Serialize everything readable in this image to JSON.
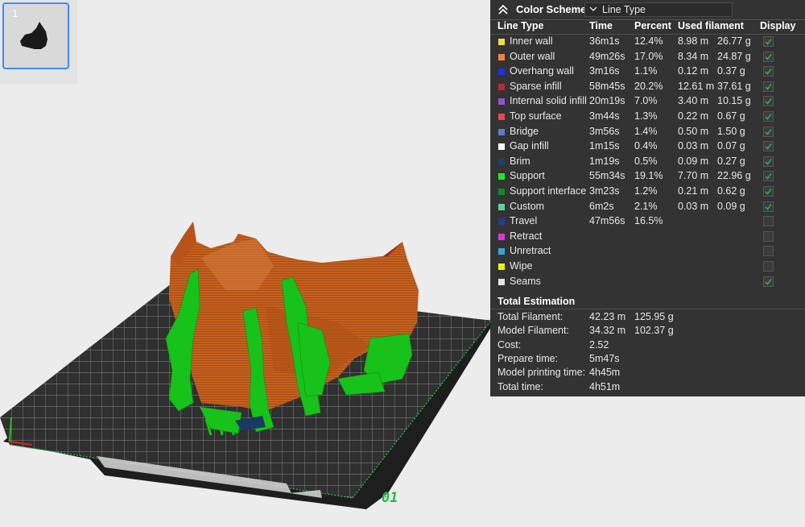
{
  "plate": {
    "thumbnail_index": "1",
    "plate_number": "01",
    "grid_color": "#2e2e2e",
    "model_color": "#c5611f",
    "support_color": "#19c11c"
  },
  "panel": {
    "title": "Color Scheme",
    "collapse_icon": "chevron-up-double-icon",
    "scheme_value": "Line Type",
    "headers": {
      "line_type": "Line Type",
      "time": "Time",
      "percent": "Percent",
      "used_filament": "Used filament",
      "display": "Display"
    },
    "rows": [
      {
        "name": "Inner wall",
        "color": "#f5dc44",
        "time": "36m1s",
        "percent": "12.4%",
        "length": "8.98 m",
        "weight": "26.77 g",
        "checked": true
      },
      {
        "name": "Outer wall",
        "color": "#f0824a",
        "time": "49m26s",
        "percent": "17.0%",
        "length": "8.34 m",
        "weight": "24.87 g",
        "checked": true
      },
      {
        "name": "Overhang wall",
        "color": "#2230e8",
        "time": "3m16s",
        "percent": "1.1%",
        "length": "0.12 m",
        "weight": "0.37 g",
        "checked": true
      },
      {
        "name": "Sparse infill",
        "color": "#b22d38",
        "time": "58m45s",
        "percent": "20.2%",
        "length": "12.61 m",
        "weight": "37.61 g",
        "checked": true
      },
      {
        "name": "Internal solid infill",
        "color": "#9b4fd1",
        "time": "20m19s",
        "percent": "7.0%",
        "length": "3.40 m",
        "weight": "10.15 g",
        "checked": true
      },
      {
        "name": "Top surface",
        "color": "#e84a4a",
        "time": "3m44s",
        "percent": "1.3%",
        "length": "0.22 m",
        "weight": "0.67 g",
        "checked": true
      },
      {
        "name": "Bridge",
        "color": "#5b7fc8",
        "time": "3m56s",
        "percent": "1.4%",
        "length": "0.50 m",
        "weight": "1.50 g",
        "checked": true
      },
      {
        "name": "Gap infill",
        "color": "#ffffff",
        "time": "1m15s",
        "percent": "0.4%",
        "length": "0.03 m",
        "weight": "0.07 g",
        "checked": true
      },
      {
        "name": "Brim",
        "color": "#1a4266",
        "time": "1m19s",
        "percent": "0.5%",
        "length": "0.09 m",
        "weight": "0.27 g",
        "checked": true
      },
      {
        "name": "Support",
        "color": "#22e82a",
        "time": "55m34s",
        "percent": "19.1%",
        "length": "7.70 m",
        "weight": "22.96 g",
        "checked": true
      },
      {
        "name": "Support interface",
        "color": "#168a22",
        "time": "3m23s",
        "percent": "1.2%",
        "length": "0.21 m",
        "weight": "0.62 g",
        "checked": true
      },
      {
        "name": "Custom",
        "color": "#5fcf9b",
        "time": "6m2s",
        "percent": "2.1%",
        "length": "0.03 m",
        "weight": "0.09 g",
        "checked": true
      },
      {
        "name": "Travel",
        "color": "#2a3a8a",
        "time": "47m56s",
        "percent": "16.5%",
        "length": "",
        "weight": "",
        "checked": false
      },
      {
        "name": "Retract",
        "color": "#d23bd2",
        "time": "",
        "percent": "",
        "length": "",
        "weight": "",
        "checked": false
      },
      {
        "name": "Unretract",
        "color": "#3aa6d8",
        "time": "",
        "percent": "",
        "length": "",
        "weight": "",
        "checked": false
      },
      {
        "name": "Wipe",
        "color": "#f2ee1a",
        "time": "",
        "percent": "",
        "length": "",
        "weight": "",
        "checked": false
      },
      {
        "name": "Seams",
        "color": "#e6e6e6",
        "time": "",
        "percent": "",
        "length": "",
        "weight": "",
        "checked": true
      }
    ],
    "estimation": {
      "title": "Total Estimation",
      "rows": [
        {
          "label": "Total Filament:",
          "value": "42.23 m",
          "extra": "125.95 g"
        },
        {
          "label": "Model Filament:",
          "value": "34.32 m",
          "extra": "102.37 g"
        },
        {
          "label": "Cost:",
          "value": "2.52",
          "extra": ""
        },
        {
          "label": "Prepare time:",
          "value": "5m47s",
          "extra": ""
        },
        {
          "label": "Model printing time:",
          "value": "4h45m",
          "extra": ""
        },
        {
          "label": "Total time:",
          "value": "4h51m",
          "extra": ""
        }
      ]
    }
  }
}
